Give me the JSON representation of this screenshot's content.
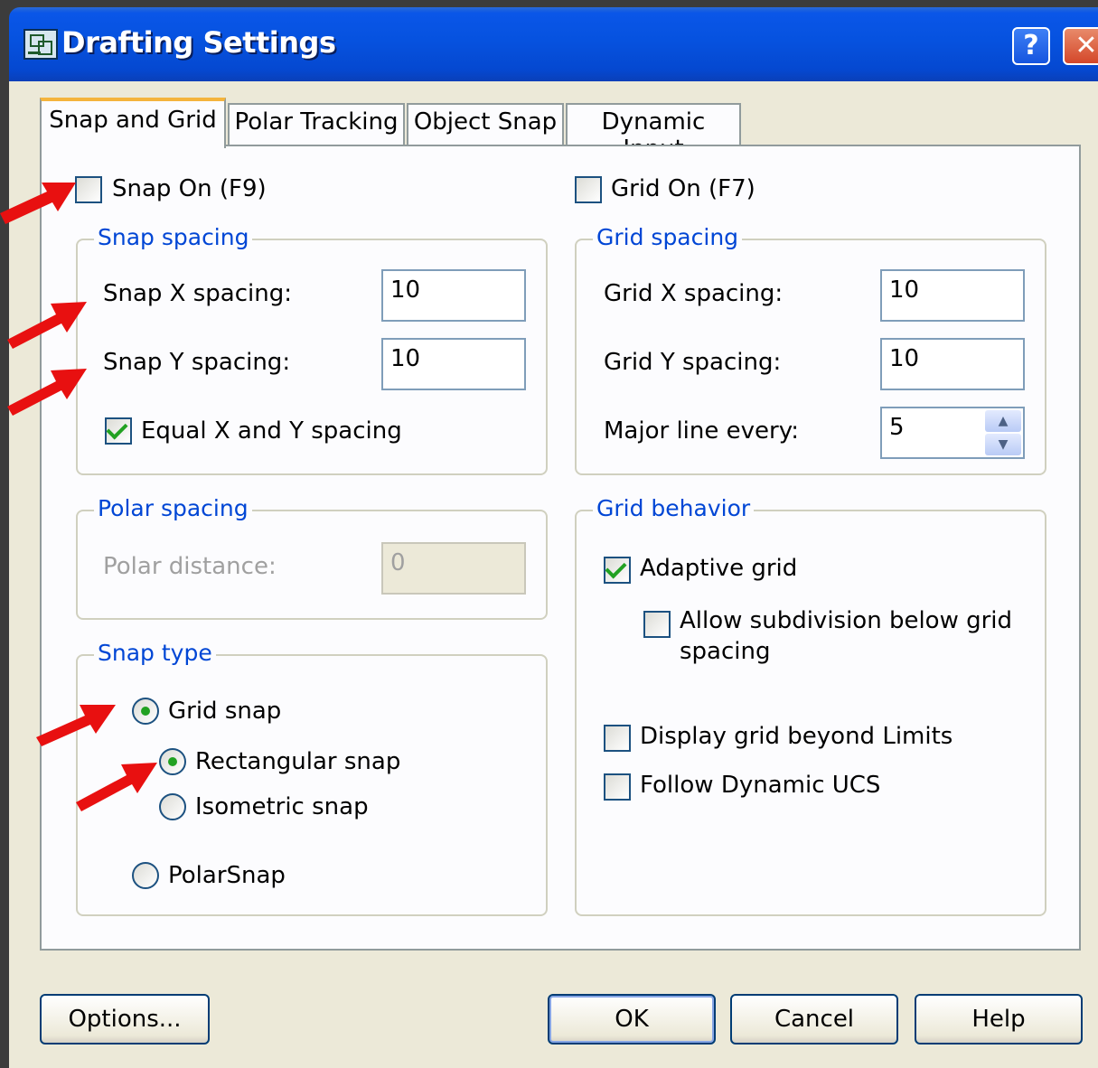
{
  "window": {
    "title": "Drafting Settings",
    "help_glyph": "?",
    "close_glyph": "✕"
  },
  "tabs": [
    {
      "label": "Snap and Grid",
      "active": true
    },
    {
      "label": "Polar Tracking",
      "active": false
    },
    {
      "label": "Object Snap",
      "active": false
    },
    {
      "label": "Dynamic Input",
      "active": false
    }
  ],
  "snap": {
    "snap_on_label": "Snap On (F9)",
    "snap_on_checked": false,
    "spacing_title": "Snap spacing",
    "x_label": "Snap X spacing:",
    "x_value": "10",
    "y_label": "Snap Y spacing:",
    "y_value": "10",
    "equal_label": "Equal X and Y spacing",
    "equal_checked": true
  },
  "polar": {
    "title": "Polar spacing",
    "distance_label": "Polar distance:",
    "distance_value": "0"
  },
  "snap_type": {
    "title": "Snap type",
    "grid_snap_label": "Grid snap",
    "rect_label": "Rectangular snap",
    "iso_label": "Isometric snap",
    "polar_label": "PolarSnap"
  },
  "grid": {
    "grid_on_label": "Grid On (F7)",
    "grid_on_checked": false,
    "spacing_title": "Grid spacing",
    "x_label": "Grid X spacing:",
    "x_value": "10",
    "y_label": "Grid Y spacing:",
    "y_value": "10",
    "major_label": "Major line every:",
    "major_value": "5"
  },
  "behavior": {
    "title": "Grid behavior",
    "adaptive_label": "Adaptive grid",
    "adaptive_checked": true,
    "subdivision_line1": "Allow subdivision below grid",
    "subdivision_line2": "spacing",
    "subdivision_checked": false,
    "beyond_label": "Display grid beyond Limits",
    "beyond_checked": false,
    "follow_label": "Follow Dynamic UCS",
    "follow_checked": false
  },
  "buttons": {
    "options": "Options...",
    "ok": "OK",
    "cancel": "Cancel",
    "help": "Help"
  },
  "colors": {
    "titlebar": "#0652df",
    "group_title": "#0046d5",
    "annotation_arrow": "#e81010",
    "check_mark": "#21a121"
  }
}
